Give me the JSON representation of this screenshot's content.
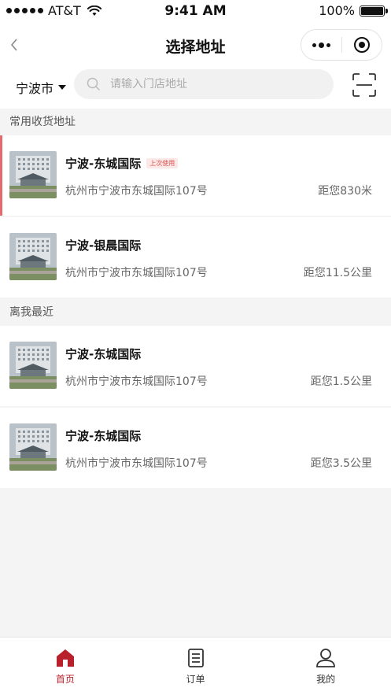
{
  "status_bar": {
    "carrier": "AT&T",
    "time": "9:41 AM",
    "battery": "100%"
  },
  "nav": {
    "title": "选择地址",
    "back_icon": "chevron-left-icon",
    "more_icon": "more-dots-icon",
    "close_icon": "target-icon"
  },
  "search": {
    "city": "宁波市",
    "placeholder": "请输入门店地址",
    "scan_icon": "scan-icon"
  },
  "sections": {
    "frequent": {
      "title": "常用收货地址",
      "items": [
        {
          "name": "宁波-东城国际",
          "badge": "上次使用",
          "address": "杭州市宁波市东城国际107号",
          "distance": "距您830米"
        },
        {
          "name": "宁波-银晨国际",
          "address": "杭州市宁波市东城国际107号",
          "distance": "距您11.5公里"
        }
      ]
    },
    "nearby": {
      "title": "离我最近",
      "items": [
        {
          "name": "宁波-东城国际",
          "address": "杭州市宁波市东城国际107号",
          "distance": "距您1.5公里"
        },
        {
          "name": "宁波-东城国际",
          "address": "杭州市宁波市东城国际107号",
          "distance": "距您3.5公里"
        }
      ]
    }
  },
  "tabbar": {
    "items": [
      {
        "label": "首页",
        "icon": "home-icon"
      },
      {
        "label": "订单",
        "icon": "order-icon"
      },
      {
        "label": "我的",
        "icon": "profile-icon"
      }
    ]
  },
  "colors": {
    "accent": "#b8212b",
    "badge_text": "#d9534f",
    "active_bar": "#e36b6e"
  }
}
